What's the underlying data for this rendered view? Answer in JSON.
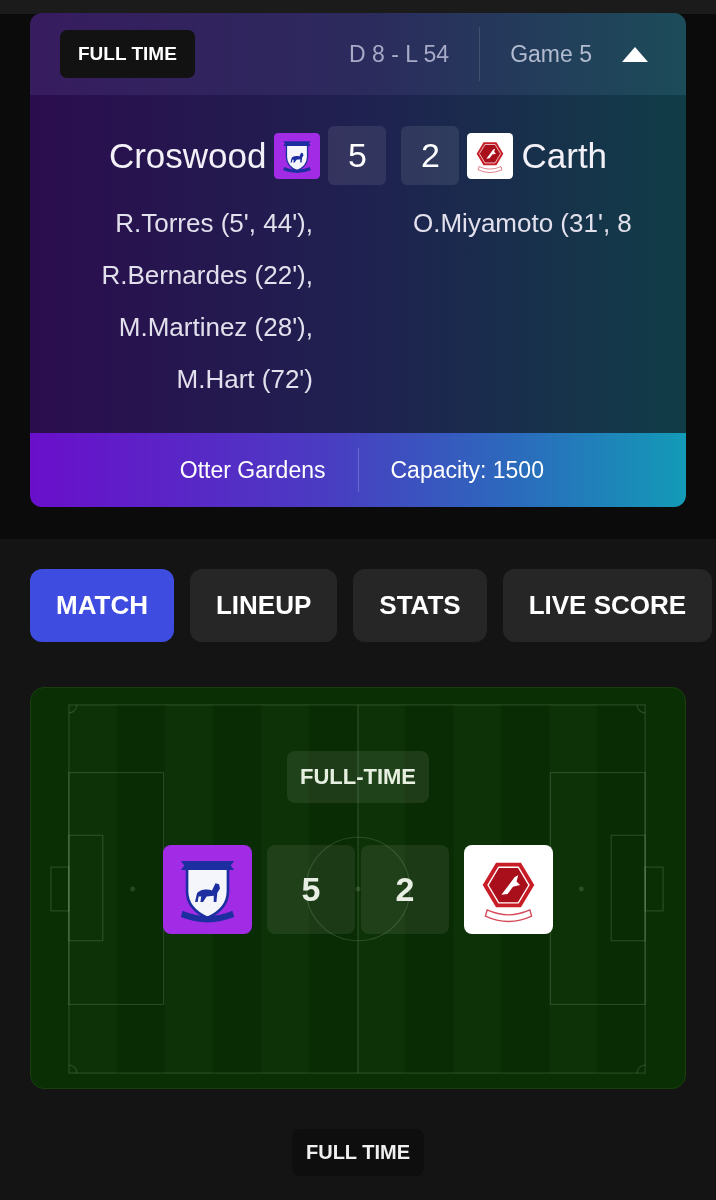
{
  "match_header": {
    "status": "FULL TIME",
    "record": "D 8 - L 54",
    "game": "Game 5",
    "expanded": true
  },
  "teams": [
    {
      "name": "Croswood",
      "kind": "shield",
      "score": "5",
      "scorers": [
        "R.Torres (5', 44'),",
        "R.Bernardes (22'),",
        "M.Martinez (28'),",
        "M.Hart (72')"
      ]
    },
    {
      "name": "Carth",
      "kind": "hexagon",
      "score": "2",
      "scorers": [
        "O.Miyamoto (31', 8"
      ]
    }
  ],
  "venue": {
    "stadium": "Otter Gardens",
    "capacity": "Capacity: 1500"
  },
  "tabs": [
    {
      "label": "MATCH",
      "selected": true
    },
    {
      "label": "LINEUP",
      "selected": false
    },
    {
      "label": "STATS",
      "selected": false
    },
    {
      "label": "LIVE SCORE",
      "selected": false
    }
  ],
  "pitch": {
    "status": "FULL-TIME",
    "sides": [
      {
        "kind": "shield",
        "score": "5"
      },
      {
        "kind": "hexagon",
        "score": "2"
      }
    ]
  },
  "footer_status": "FULL TIME"
}
